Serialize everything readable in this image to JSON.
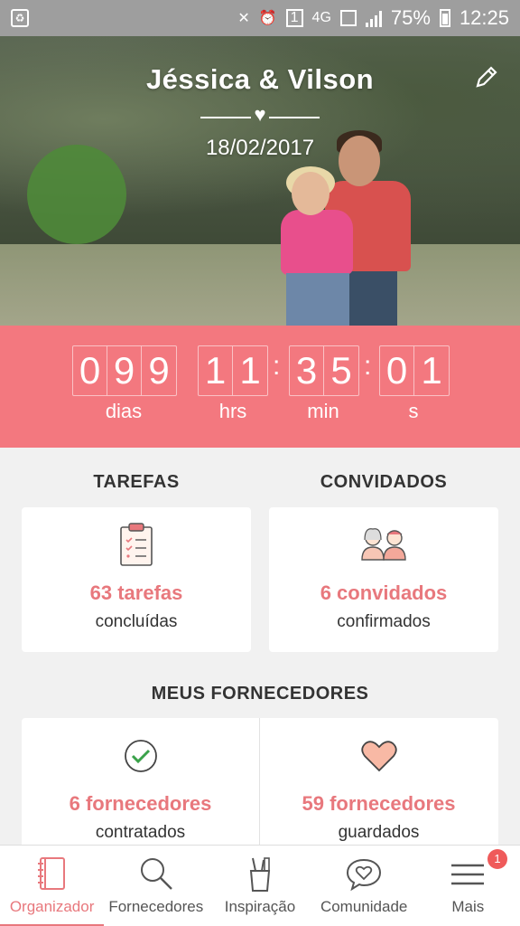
{
  "status_bar": {
    "battery_percent": "75%",
    "time": "12:25",
    "network": "4G",
    "sim": "1"
  },
  "hero": {
    "names": "Jéssica & Vilson",
    "date": "18/02/2017"
  },
  "countdown": {
    "days": [
      "0",
      "9",
      "9"
    ],
    "hours": [
      "1",
      "1"
    ],
    "minutes": [
      "3",
      "5"
    ],
    "seconds": [
      "0",
      "1"
    ],
    "labels": {
      "days": "dias",
      "hours": "hrs",
      "minutes": "min",
      "seconds": "s"
    }
  },
  "tasks": {
    "title": "TAREFAS",
    "value": "63 tarefas",
    "sub": "concluídas"
  },
  "guests": {
    "title": "CONVIDADOS",
    "value": "6 convidados",
    "sub": "confirmados"
  },
  "vendors": {
    "title": "MEUS FORNECEDORES",
    "hired": {
      "value": "6 fornecedores",
      "sub": "contratados"
    },
    "saved": {
      "value": "59 fornecedores",
      "sub": "guardados"
    }
  },
  "bottom_nav": {
    "items": [
      {
        "label": "Organizador",
        "icon": "notebook-icon",
        "active": true
      },
      {
        "label": "Fornecedores",
        "icon": "search-icon",
        "active": false
      },
      {
        "label": "Inspiração",
        "icon": "pencil-cup-icon",
        "active": false
      },
      {
        "label": "Comunidade",
        "icon": "chat-heart-icon",
        "active": false
      },
      {
        "label": "Mais",
        "icon": "menu-icon",
        "active": false,
        "badge": "1"
      }
    ]
  },
  "colors": {
    "accent": "#f3787f",
    "accent_text": "#e8787d",
    "status_bar": "#9e9e9e"
  }
}
